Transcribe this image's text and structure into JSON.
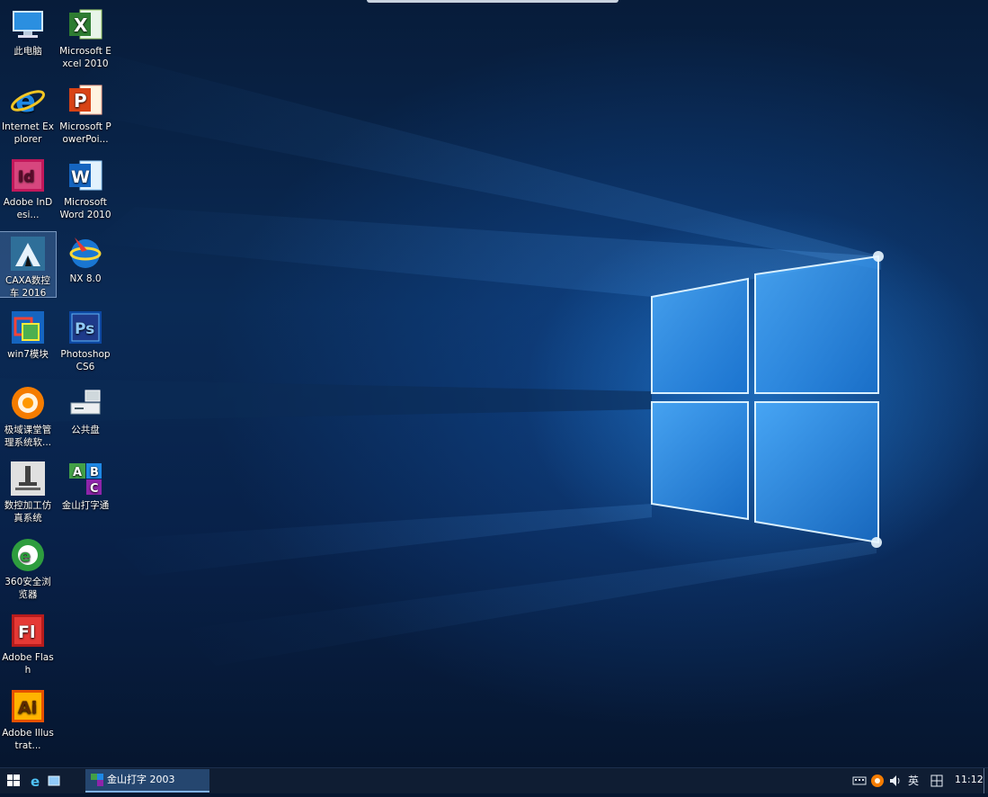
{
  "desktop": {
    "icons": [
      {
        "id": "this-pc",
        "label": "此电脑",
        "icon": "computer-icon"
      },
      {
        "id": "excel",
        "label": "Microsoft Excel 2010",
        "icon": "excel-icon"
      },
      {
        "id": "ie",
        "label": "Internet Explorer",
        "icon": "internet-explorer-icon"
      },
      {
        "id": "powerpoint",
        "label": "Microsoft PowerPoi...",
        "icon": "powerpoint-icon"
      },
      {
        "id": "indesign",
        "label": "Adobe InDesi...",
        "icon": "indesign-icon"
      },
      {
        "id": "word",
        "label": "Microsoft Word 2010",
        "icon": "word-icon"
      },
      {
        "id": "caxa",
        "label": "CAXA数控车 2016",
        "icon": "caxa-icon"
      },
      {
        "id": "nx",
        "label": "NX 8.0",
        "icon": "nx-icon"
      },
      {
        "id": "win7",
        "label": "win7模块",
        "icon": "win7-module-icon"
      },
      {
        "id": "photoshop",
        "label": "Photoshop CS6",
        "icon": "photoshop-icon"
      },
      {
        "id": "jiyu",
        "label": "极域课堂管理系统软...",
        "icon": "classroom-icon"
      },
      {
        "id": "public",
        "label": "公共盘",
        "icon": "network-drive-icon"
      },
      {
        "id": "cnc",
        "label": "数控加工仿真系统",
        "icon": "cnc-simulation-icon"
      },
      {
        "id": "typing",
        "label": "金山打字通",
        "icon": "typing-icon"
      },
      {
        "id": "360",
        "label": "360安全浏览器",
        "icon": "browser-360-icon"
      },
      {
        "id": "flash",
        "label": "Adobe Flash",
        "icon": "flash-icon"
      },
      {
        "id": "illustrator",
        "label": "Adobe Illustrat...",
        "icon": "illustrator-icon"
      }
    ]
  },
  "taskbar": {
    "start_icon": "windows-start-icon",
    "quick_launch": [
      "internet-explorer-icon",
      "file-explorer-icon"
    ],
    "active_task": {
      "label": "金山打字 2003",
      "icon": "typing-icon"
    },
    "tray": {
      "ime_label": "英",
      "time": "11:12"
    }
  },
  "colors": {
    "accent": "#1e7fe0",
    "taskbar": "#0f1d33",
    "active_task": "#25466f"
  }
}
